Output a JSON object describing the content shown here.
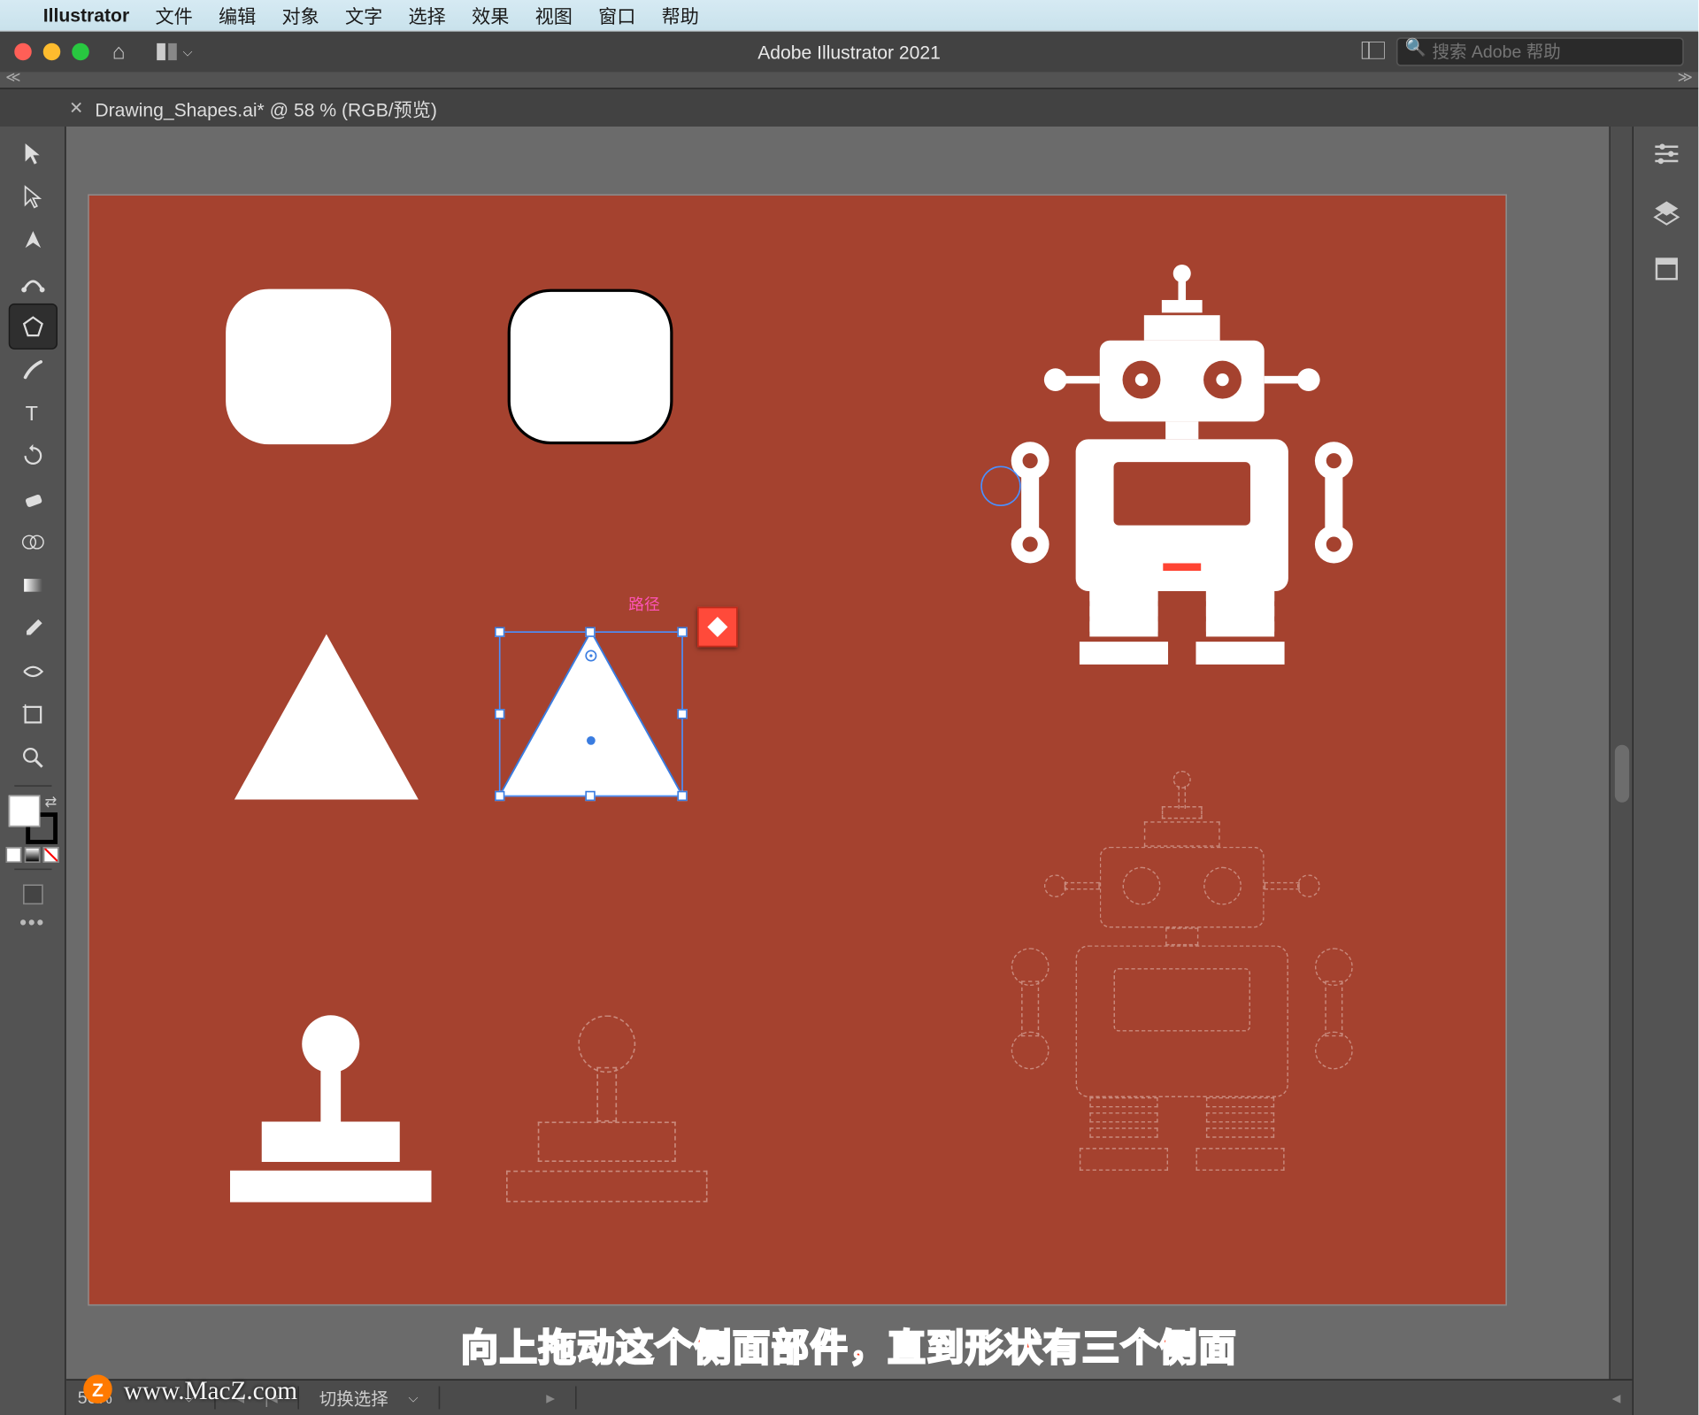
{
  "mac_menu": {
    "app": "Illustrator",
    "items": [
      "文件",
      "编辑",
      "对象",
      "文字",
      "选择",
      "效果",
      "视图",
      "窗口",
      "帮助"
    ]
  },
  "titlebar": {
    "title": "Adobe Illustrator 2021",
    "search_placeholder": "搜索 Adobe 帮助"
  },
  "document_tab": {
    "label": "Drawing_Shapes.ai* @ 58 % (RGB/预览)"
  },
  "tools": [
    {
      "name": "selection-tool",
      "glyph": "select"
    },
    {
      "name": "direct-selection-tool",
      "glyph": "dselect"
    },
    {
      "name": "pen-tool",
      "glyph": "pen"
    },
    {
      "name": "curvature-tool",
      "glyph": "curve"
    },
    {
      "name": "polygon-tool",
      "glyph": "polygon",
      "selected": true
    },
    {
      "name": "paintbrush-tool",
      "glyph": "brush"
    },
    {
      "name": "type-tool",
      "glyph": "type"
    },
    {
      "name": "rotate-tool",
      "glyph": "rotate"
    },
    {
      "name": "eraser-tool",
      "glyph": "eraser"
    },
    {
      "name": "shape-builder-tool",
      "glyph": "shapebuild"
    },
    {
      "name": "gradient-tool",
      "glyph": "gradient"
    },
    {
      "name": "eyedropper-tool",
      "glyph": "eyedrop"
    },
    {
      "name": "width-tool",
      "glyph": "width"
    },
    {
      "name": "artboard-tool",
      "glyph": "artboard"
    },
    {
      "name": "zoom-tool",
      "glyph": "zoom"
    }
  ],
  "right_dock": [
    {
      "name": "properties-icon",
      "glyph": "sliders"
    },
    {
      "name": "layers-icon",
      "glyph": "layers"
    },
    {
      "name": "libraries-icon",
      "glyph": "library"
    }
  ],
  "status_bar": {
    "zoom": "50%",
    "label": "切换选择"
  },
  "canvas": {
    "path_label": "路径"
  },
  "overlay": {
    "subtitle": "向上拖动这个侧面部件，直到形状有三个侧面",
    "watermark": "www.MacZ.com",
    "badge": "Z"
  }
}
